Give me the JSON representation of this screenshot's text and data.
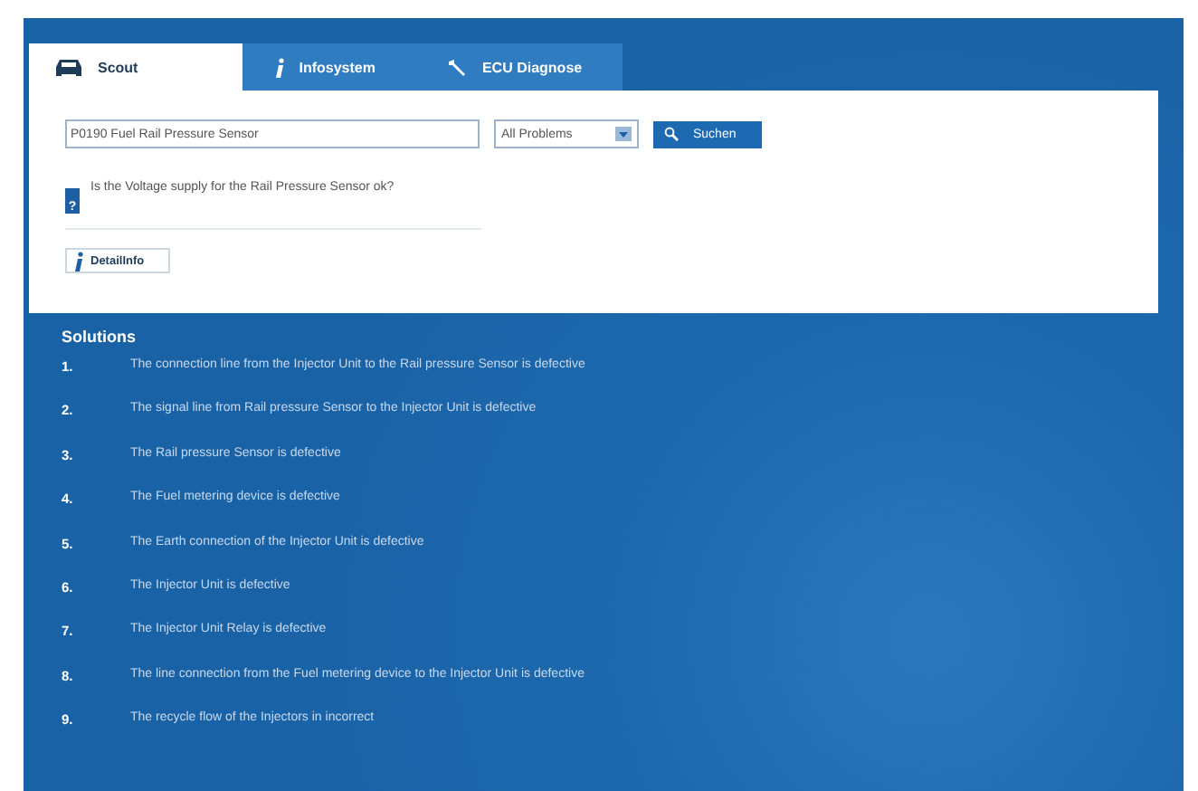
{
  "tabs": [
    {
      "label": "Scout",
      "selected": true
    },
    {
      "label": "Infosystem",
      "selected": false
    },
    {
      "label": "ECU Diagnose",
      "selected": false
    }
  ],
  "search": {
    "value": "P0190 Fuel Rail Pressure Sensor",
    "filter": "All Problems",
    "button": "Suchen"
  },
  "question": {
    "badge": "?",
    "text": "Is the Voltage supply for the Rail Pressure Sensor ok?"
  },
  "detail_button": "DetailInfo",
  "solutions": {
    "title": "Solutions",
    "items": [
      {
        "number": "1.",
        "text": "The connection line from the Injector Unit to the Rail pressure Sensor is defective"
      },
      {
        "number": "2.",
        "text": "The signal line from Rail pressure Sensor to the Injector Unit is defective"
      },
      {
        "number": "3.",
        "text": "The Rail pressure Sensor is defective"
      },
      {
        "number": "4.",
        "text": "The Fuel metering device is defective"
      },
      {
        "number": "5.",
        "text": "The Earth connection of the Injector Unit is defective"
      },
      {
        "number": "6.",
        "text": "The Injector Unit is defective"
      },
      {
        "number": "7.",
        "text": "The Injector Unit Relay is defective"
      },
      {
        "number": "8.",
        "text": "The line connection from the Fuel metering device to the Injector Unit is defective"
      },
      {
        "number": "9.",
        "text": "The recycle flow of the Injectors in incorrect"
      }
    ]
  }
}
